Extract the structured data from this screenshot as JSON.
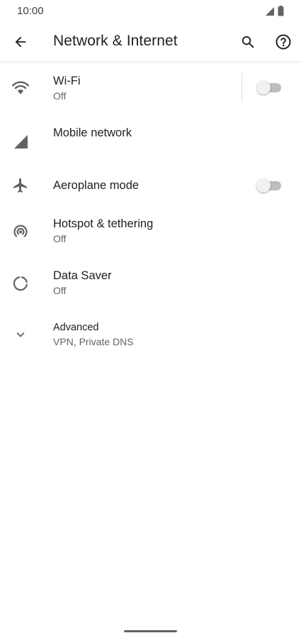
{
  "status_bar": {
    "time": "10:00",
    "icons": [
      "signal-icon",
      "battery-icon"
    ]
  },
  "app_bar": {
    "title": "Network & Internet",
    "back_icon": "arrow-back-icon",
    "search_icon": "search-icon",
    "help_icon": "help-icon"
  },
  "items": [
    {
      "title": "Wi-Fi",
      "subtitle": "Off",
      "icon": "wifi-icon",
      "toggle_on": false
    },
    {
      "title": "Mobile network",
      "icon": "signal-icon"
    },
    {
      "title": "Aeroplane mode",
      "icon": "airplane-icon",
      "toggle_on": false
    },
    {
      "title": "Hotspot & tethering",
      "subtitle": "Off",
      "icon": "hotspot-icon"
    },
    {
      "title": "Data Saver",
      "subtitle": "Off",
      "icon": "data-saver-icon"
    },
    {
      "title": "Advanced",
      "subtitle": "VPN, Private DNS",
      "icon": "chevron-down-icon"
    }
  ],
  "colors": {
    "icon": "#5f6368",
    "text": "#202124",
    "secondary_text": "#5f6368",
    "toggle_track": "#bdbdbd",
    "toggle_thumb": "#f1f1f1"
  }
}
